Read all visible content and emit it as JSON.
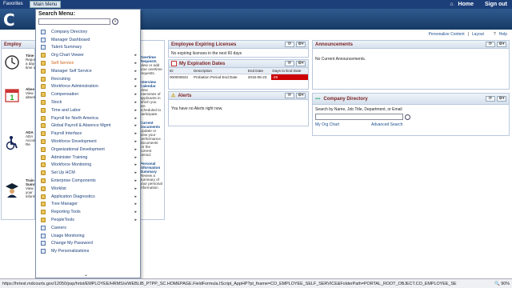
{
  "topbar": {
    "favorites": "Favorites",
    "main_menu": "Main Menu",
    "home": "Home",
    "signout": "Sign out"
  },
  "banner": {
    "logo": "C"
  },
  "personalize": {
    "content": "Personalize Content",
    "layout": "Layout",
    "help": "Help"
  },
  "menu": {
    "title": "Search Menu:",
    "search_value": "",
    "items": [
      {
        "label": "Company Directory",
        "type": "page",
        "arrow": false
      },
      {
        "label": "Manager Dashboard",
        "type": "page",
        "arrow": false
      },
      {
        "label": "Talent Summary",
        "type": "page",
        "arrow": false
      },
      {
        "label": "Org Chart Viewer",
        "type": "folder",
        "arrow": true
      },
      {
        "label": "Self Service",
        "type": "folder",
        "arrow": true,
        "selected": true
      },
      {
        "label": "Manager Self Service",
        "type": "folder",
        "arrow": true
      },
      {
        "label": "Recruiting",
        "type": "folder",
        "arrow": true
      },
      {
        "label": "Workforce Administration",
        "type": "folder",
        "arrow": true
      },
      {
        "label": "Compensation",
        "type": "folder",
        "arrow": true
      },
      {
        "label": "Stock",
        "type": "folder",
        "arrow": true
      },
      {
        "label": "Time and Labor",
        "type": "folder",
        "arrow": true
      },
      {
        "label": "Payroll for North America",
        "type": "folder",
        "arrow": true
      },
      {
        "label": "Global Payroll & Absence Mgmt",
        "type": "folder",
        "arrow": true
      },
      {
        "label": "Payroll Interface",
        "type": "folder",
        "arrow": true
      },
      {
        "label": "Workforce Development",
        "type": "folder",
        "arrow": true
      },
      {
        "label": "Organizational Development",
        "type": "folder",
        "arrow": true
      },
      {
        "label": "Administer Training",
        "type": "folder",
        "arrow": true
      },
      {
        "label": "Workforce Monitoring",
        "type": "folder",
        "arrow": true
      },
      {
        "label": "Set Up HCM",
        "type": "folder",
        "arrow": true
      },
      {
        "label": "Enterprise Components",
        "type": "folder",
        "arrow": true
      },
      {
        "label": "Worklist",
        "type": "folder",
        "arrow": true
      },
      {
        "label": "Application Diagnostics",
        "type": "folder",
        "arrow": true
      },
      {
        "label": "Tree Manager",
        "type": "folder",
        "arrow": true
      },
      {
        "label": "Reporting Tools",
        "type": "folder",
        "arrow": true
      },
      {
        "label": "PeopleTools",
        "type": "folder",
        "arrow": true
      },
      {
        "label": "Careers",
        "type": "page",
        "arrow": false
      },
      {
        "label": "Usage Monitoring",
        "type": "page",
        "arrow": false
      },
      {
        "label": "Change My Password",
        "type": "page",
        "arrow": false
      },
      {
        "label": "My Personalizations",
        "type": "page",
        "arrow": false
      }
    ]
  },
  "left": {
    "header": "Employ",
    "cells": [
      {
        "title": "Time",
        "desc": "Report a day time o"
      },
      {
        "title": "Abse",
        "desc": "View absen"
      },
      {
        "title": "ADA",
        "desc": "ADA Accom Re"
      },
      {
        "title": "Train Sumr",
        "desc": "View your informa"
      }
    ]
  },
  "mid": {
    "items": [
      {
        "link": "Overtime Requests",
        "desc": "View or add your overtime requests."
      },
      {
        "link": "Interview Calendar",
        "desc": "View interviews of applicants in which you are scheduled to participate."
      },
      {
        "link": "Current Documents",
        "desc": "Update or view your performance documents for the current period."
      },
      {
        "link": "Personal Information Summary",
        "desc": "Review a summary of your personal information"
      }
    ]
  },
  "licenses": {
    "title": "Employee Expiring Licenses",
    "msg": "No expiring licenses in the next 60 days"
  },
  "expiration": {
    "title": "My Expiration Dates",
    "cols": [
      "ID",
      "Description",
      "End Date",
      "Days to End Date"
    ],
    "row": [
      "000000642",
      "Probation Period End Date",
      "2016-06-23",
      "-29"
    ]
  },
  "alerts": {
    "title": "Alerts",
    "msg": "You have no Alerts right now."
  },
  "announce": {
    "title": "Announcements",
    "msg": "No Current Announcements."
  },
  "directory": {
    "title": "Company Directory",
    "hint": "Search by Name, Job Title, Department, or Email",
    "orgchart": "My Org Chart",
    "adv": "Advanced Search"
  },
  "status": {
    "url": "https://hrtest.mdcourts.gov/12050/psp/hrtst/EMPLOYEE/HRMS/s/WEBLIB_PTPP_SC.HOMEPAGE.FieldFormula.IScript_AppHP?pt_fname=CO_EMPLOYEE_SELF_SERVICE&FolderPath=PORTAL_ROOT_OBJECT.CO_EMPLOYEE_SE",
    "zoom": "90%"
  },
  "colors": {
    "topbar": "#1c3f7a",
    "accent": "#7a1f1f",
    "alert_red": "#cc0000"
  }
}
